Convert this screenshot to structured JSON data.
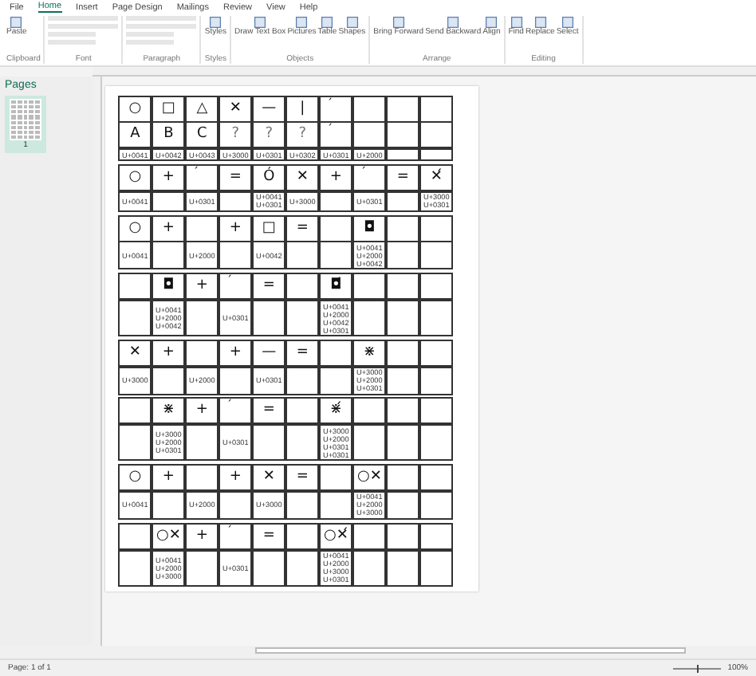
{
  "tabs": [
    {
      "label": "File",
      "selected": false
    },
    {
      "label": "Home",
      "selected": true
    },
    {
      "label": "Insert",
      "selected": false
    },
    {
      "label": "Page Design",
      "selected": false
    },
    {
      "label": "Mailings",
      "selected": false
    },
    {
      "label": "Review",
      "selected": false
    },
    {
      "label": "View",
      "selected": false
    },
    {
      "label": "Help",
      "selected": false
    }
  ],
  "ribbon_groups": [
    {
      "label": "Clipboard",
      "buttons": [
        "Paste"
      ]
    },
    {
      "label": "Font"
    },
    {
      "label": "Paragraph"
    },
    {
      "label": "Styles",
      "buttons": [
        "Styles"
      ]
    },
    {
      "label": "Objects",
      "buttons": [
        "Draw Text Box",
        "Pictures",
        "Table",
        "Shapes"
      ]
    },
    {
      "label": "Arrange",
      "buttons": [
        "Bring Forward",
        "Send Backward",
        "Align"
      ]
    },
    {
      "label": "Editing",
      "buttons": [
        "Find",
        "Replace",
        "Select"
      ]
    }
  ],
  "pages_panel": {
    "title": "Pages",
    "page_number": "1"
  },
  "table": {
    "blocks": [
      {
        "rows": [
          {
            "kind": "symbol",
            "cells": [
              {
                "text": "○"
              },
              {
                "text": "□"
              },
              {
                "text": "△"
              },
              {
                "text": "✕"
              },
              {
                "text": "—"
              },
              {
                "text": "|"
              },
              {
                "text": "´",
                "kind": "accent"
              },
              {},
              {},
              {}
            ]
          },
          {
            "kind": "symbol",
            "cells": [
              {
                "text": "A"
              },
              {
                "text": "B"
              },
              {
                "text": "C"
              },
              {
                "text": "?",
                "kind": "missing"
              },
              {
                "text": "?",
                "kind": "missing"
              },
              {
                "text": "?",
                "kind": "missing"
              },
              {
                "text": "´",
                "kind": "accent"
              },
              {},
              {},
              {}
            ]
          },
          {
            "kind": "code",
            "cells": [
              {
                "lines": [
                  "U+0041"
                ]
              },
              {
                "lines": [
                  "U+0042"
                ]
              },
              {
                "lines": [
                  "U+0043"
                ]
              },
              {
                "lines": [
                  "U+3000"
                ]
              },
              {
                "lines": [
                  "U+0301"
                ]
              },
              {
                "lines": [
                  "U+0302"
                ]
              },
              {
                "lines": [
                  "U+0301"
                ]
              },
              {
                "lines": [
                  "U+2000"
                ]
              },
              {},
              {}
            ]
          }
        ]
      },
      {
        "rows": [
          {
            "kind": "symbol",
            "cells": [
              {
                "text": "○"
              },
              {
                "text": "+"
              },
              {
                "text": "´",
                "kind": "accent"
              },
              {
                "text": "="
              },
              {
                "text": "Ó"
              },
              {
                "text": "✕"
              },
              {
                "text": "+"
              },
              {
                "text": "´",
                "kind": "accent"
              },
              {
                "text": "="
              },
              {
                "text": "✕́"
              }
            ]
          },
          {
            "kind": "code",
            "cells": [
              {
                "lines": [
                  "U+0041"
                ]
              },
              {},
              {
                "lines": [
                  "U+0301"
                ]
              },
              {},
              {
                "lines": [
                  "U+0041",
                  "U+0301"
                ]
              },
              {
                "lines": [
                  "U+3000"
                ]
              },
              {},
              {
                "lines": [
                  "U+0301"
                ]
              },
              {},
              {
                "lines": [
                  "U+3000",
                  "U+0301"
                ]
              }
            ]
          }
        ]
      },
      {
        "rows": [
          {
            "kind": "symbol",
            "cells": [
              {
                "text": "○"
              },
              {
                "text": "+"
              },
              {},
              {
                "text": "+"
              },
              {
                "text": "□"
              },
              {
                "text": "="
              },
              {},
              {
                "text": "◘"
              },
              {},
              {}
            ]
          },
          {
            "kind": "code",
            "cells": [
              {
                "lines": [
                  "U+0041"
                ]
              },
              {},
              {
                "lines": [
                  "U+2000"
                ]
              },
              {},
              {
                "lines": [
                  "U+0042"
                ]
              },
              {},
              {},
              {
                "lines": [
                  "U+0041",
                  "U+2000",
                  "U+0042"
                ]
              },
              {},
              {}
            ]
          }
        ]
      },
      {
        "rows": [
          {
            "kind": "symbol",
            "cells": [
              {},
              {
                "text": "◘"
              },
              {
                "text": "+"
              },
              {
                "text": "´",
                "kind": "accent"
              },
              {
                "text": "="
              },
              {},
              {
                "text": "◘́"
              },
              {},
              {},
              {}
            ]
          },
          {
            "kind": "code",
            "cells": [
              {},
              {
                "lines": [
                  "U+0041",
                  "U+2000",
                  "U+0042"
                ]
              },
              {},
              {
                "lines": [
                  "U+0301"
                ]
              },
              {},
              {},
              {
                "lines": [
                  "U+0041",
                  "U+2000",
                  "U+0042",
                  "U+0301"
                ]
              },
              {},
              {},
              {}
            ]
          }
        ]
      },
      {
        "rows": [
          {
            "kind": "symbol",
            "cells": [
              {
                "text": "✕"
              },
              {
                "text": "+"
              },
              {},
              {
                "text": "+"
              },
              {
                "text": "—"
              },
              {
                "text": "="
              },
              {},
              {
                "text": "⋇"
              },
              {},
              {}
            ]
          },
          {
            "kind": "code",
            "cells": [
              {
                "lines": [
                  "U+3000"
                ]
              },
              {},
              {
                "lines": [
                  "U+2000"
                ]
              },
              {},
              {
                "lines": [
                  "U+0301"
                ]
              },
              {},
              {},
              {
                "lines": [
                  "U+3000",
                  "U+2000",
                  "U+0301"
                ]
              },
              {},
              {}
            ]
          }
        ]
      },
      {
        "rows": [
          {
            "kind": "symbol",
            "cells": [
              {},
              {
                "text": "⋇"
              },
              {
                "text": "+"
              },
              {
                "text": "´",
                "kind": "accent"
              },
              {
                "text": "="
              },
              {},
              {
                "text": "⋇́"
              },
              {},
              {},
              {}
            ]
          },
          {
            "kind": "code",
            "cells": [
              {},
              {
                "lines": [
                  "U+3000",
                  "U+2000",
                  "U+0301"
                ]
              },
              {},
              {
                "lines": [
                  "U+0301"
                ]
              },
              {},
              {},
              {
                "lines": [
                  "U+3000",
                  "U+2000",
                  "U+0301",
                  "U+0301"
                ]
              },
              {},
              {},
              {}
            ]
          }
        ]
      },
      {
        "rows": [
          {
            "kind": "symbol",
            "cells": [
              {
                "text": "○"
              },
              {
                "text": "+"
              },
              {},
              {
                "text": "+"
              },
              {
                "text": "✕"
              },
              {
                "text": "="
              },
              {},
              {
                "text": "○✕"
              },
              {},
              {}
            ]
          },
          {
            "kind": "code",
            "cells": [
              {
                "lines": [
                  "U+0041"
                ]
              },
              {},
              {
                "lines": [
                  "U+2000"
                ]
              },
              {},
              {
                "lines": [
                  "U+3000"
                ]
              },
              {},
              {},
              {
                "lines": [
                  "U+0041",
                  "U+2000",
                  "U+3000"
                ]
              },
              {},
              {}
            ]
          }
        ]
      },
      {
        "rows": [
          {
            "kind": "symbol",
            "cells": [
              {},
              {
                "text": "○✕"
              },
              {
                "text": "+"
              },
              {
                "text": "´",
                "kind": "accent"
              },
              {
                "text": "="
              },
              {},
              {
                "text": "○✕́"
              },
              {},
              {},
              {}
            ]
          },
          {
            "kind": "code",
            "cells": [
              {},
              {
                "lines": [
                  "U+0041",
                  "U+2000",
                  "U+3000"
                ]
              },
              {},
              {
                "lines": [
                  "U+0301"
                ]
              },
              {},
              {},
              {
                "lines": [
                  "U+0041",
                  "U+2000",
                  "U+3000",
                  "U+0301"
                ]
              },
              {},
              {},
              {}
            ]
          }
        ]
      }
    ]
  },
  "status_bar": {
    "page": "Page: 1 of 1",
    "zoom_slider": {
      "level": 0.5
    },
    "zoom": "100%"
  }
}
